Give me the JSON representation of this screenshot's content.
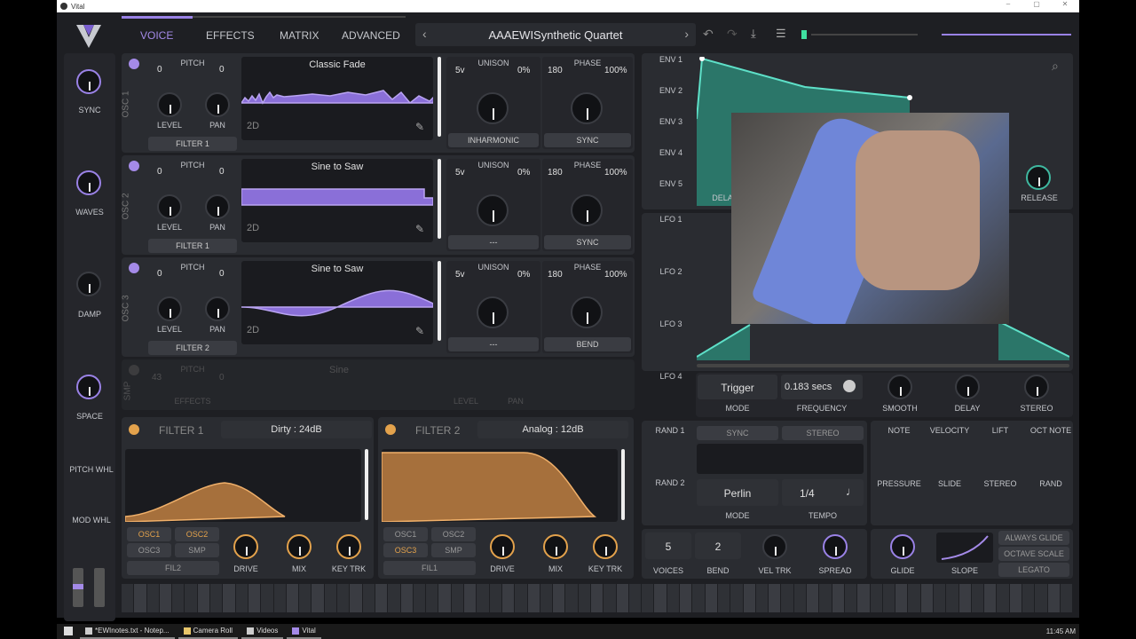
{
  "window": {
    "title": "Vital",
    "min": "–",
    "max": "▢",
    "close": "✕"
  },
  "nav": {
    "tabs": [
      "VOICE",
      "EFFECTS",
      "MATRIX",
      "ADVANCED"
    ],
    "preset": "AAAEWISynthetic Quartet",
    "prev": "‹",
    "next": "›"
  },
  "macros": {
    "labels": [
      "SYNC",
      "WAVES",
      "DAMP",
      "SPACE"
    ],
    "pitch_wheel": "PITCH WHL",
    "mod_wheel": "MOD WHL"
  },
  "oscs": [
    {
      "name": "OSC 1",
      "pitch_label": "PITCH",
      "pitch_left": "0",
      "pitch_right": "0",
      "level": "LEVEL",
      "pan": "PAN",
      "wave": "Classic Fade",
      "filter": "FILTER 1",
      "dim": "2D",
      "unison_label": "UNISON",
      "voices": "5v",
      "unison_pct": "0%",
      "phase_label": "PHASE",
      "phase": "180",
      "phase_pct": "100%",
      "mode_a": "INHARMONIC",
      "mode_b": "SYNC"
    },
    {
      "name": "OSC 2",
      "pitch_label": "PITCH",
      "pitch_left": "0",
      "pitch_right": "0",
      "level": "LEVEL",
      "pan": "PAN",
      "wave": "Sine to Saw",
      "filter": "FILTER 1",
      "dim": "2D",
      "unison_label": "UNISON",
      "voices": "5v",
      "unison_pct": "0%",
      "phase_label": "PHASE",
      "phase": "180",
      "phase_pct": "100%",
      "mode_a": "---",
      "mode_b": "SYNC"
    },
    {
      "name": "OSC 3",
      "pitch_label": "PITCH",
      "pitch_left": "0",
      "pitch_right": "0",
      "level": "LEVEL",
      "pan": "PAN",
      "wave": "Sine to Saw",
      "filter": "FILTER 2",
      "dim": "2D",
      "unison_label": "UNISON",
      "voices": "5v",
      "unison_pct": "0%",
      "phase_label": "PHASE",
      "phase": "180",
      "phase_pct": "100%",
      "mode_a": "---",
      "mode_b": "BEND"
    }
  ],
  "smp": {
    "name": "SMP",
    "pitch": "PITCH",
    "left": "43",
    "right": "0",
    "wave": "Sine",
    "effects": "EFFECTS",
    "level": "LEVEL",
    "pan": "PAN"
  },
  "filters": [
    {
      "name": "FILTER 1",
      "type": "Dirty : 24dB",
      "srcs": [
        "OSC1",
        "OSC2",
        "OSC3",
        "SMP"
      ],
      "route": "FIL2",
      "drive": "DRIVE",
      "mix": "MIX",
      "keytrk": "KEY TRK"
    },
    {
      "name": "FILTER 2",
      "type": "Analog : 12dB",
      "srcs": [
        "OSC1",
        "OSC2",
        "OSC3",
        "SMP"
      ],
      "route": "FIL1",
      "drive": "DRIVE",
      "mix": "MIX",
      "keytrk": "KEY TRK"
    }
  ],
  "env": {
    "tabs": [
      "ENV 1",
      "ENV 2",
      "ENV 3",
      "ENV 4",
      "ENV 5"
    ],
    "delay": "DELA",
    "release": "RELEASE"
  },
  "lfo": {
    "tabs": [
      "LFO 1",
      "LFO 2",
      "LFO 3",
      "LFO 4"
    ],
    "trigger": "Trigger",
    "mode": "MODE",
    "freq_value": "0.183 secs",
    "frequency": "FREQUENCY",
    "smooth": "SMOOTH",
    "delay": "DELAY",
    "stereo": "STEREO"
  },
  "rand": {
    "tabs": [
      "RAND 1",
      "RAND 2"
    ],
    "sync": "SYNC",
    "stereo": "STEREO",
    "type": "Perlin",
    "mode": "MODE",
    "tempo_value": "1/4",
    "tempo": "TEMPO"
  },
  "mods": {
    "row1": [
      "NOTE",
      "VELOCITY",
      "LIFT",
      "OCT NOTE"
    ],
    "row2": [
      "PRESSURE",
      "SLIDE",
      "STEREO",
      "RAND"
    ]
  },
  "voice": {
    "voices_value": "5",
    "voices": "VOICES",
    "bend_value": "2",
    "bend": "BEND",
    "veltrk": "VEL TRK",
    "spread": "SPREAD",
    "glide": "GLIDE",
    "slope": "SLOPE",
    "always": "ALWAYS GLIDE",
    "octave": "OCTAVE SCALE",
    "legato": "LEGATO"
  },
  "taskbar": {
    "items": [
      "*EWInotes.txt - Notep...",
      "Camera Roll",
      "Videos",
      "Vital"
    ],
    "clock": "11:45 AM"
  },
  "colors": {
    "accent": "#a48ae8",
    "filter": "#e3a24c",
    "env": "#3fb8a0"
  }
}
